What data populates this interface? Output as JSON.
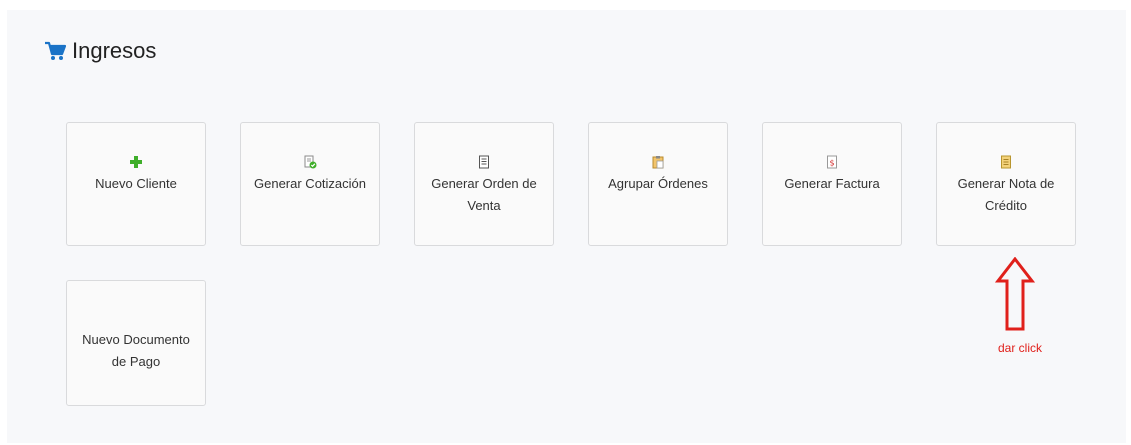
{
  "header": {
    "title": "Ingresos",
    "icon": "shopping-cart-icon",
    "icon_color": "#1a73c7"
  },
  "tiles": [
    {
      "label": "Nuevo Cliente",
      "icon": "green-plus-icon"
    },
    {
      "label": "Generar Cotización",
      "icon": "document-check-icon"
    },
    {
      "label": "Generar Orden de Venta",
      "icon": "document-list-icon"
    },
    {
      "label": "Agrupar Órdenes",
      "icon": "clipboard-icon"
    },
    {
      "label": "Generar Factura",
      "icon": "invoice-dollar-icon"
    },
    {
      "label": "Generar Nota de Crédito",
      "icon": "note-icon"
    },
    {
      "label": "Nuevo Documento de Pago",
      "icon": ""
    }
  ],
  "annotation": {
    "text": "dar click",
    "color": "#e0201b"
  }
}
